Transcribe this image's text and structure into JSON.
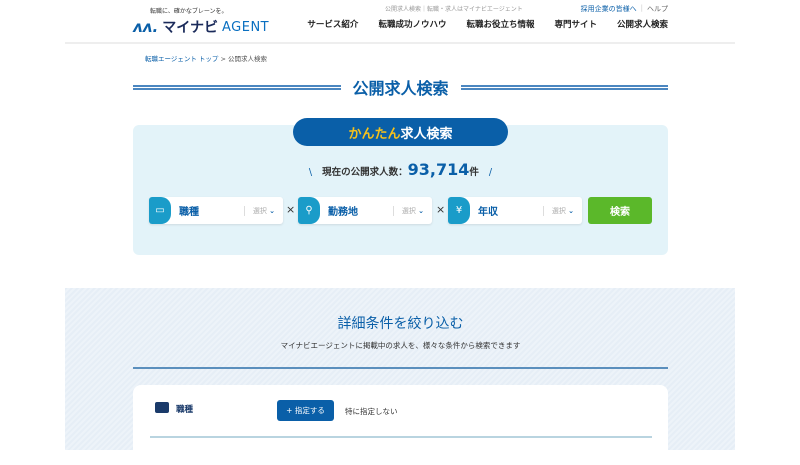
{
  "header": {
    "tagline": "転職に、確かなブレーンを。",
    "logo": {
      "brand": "マイナビ",
      "suffix": "AGENT"
    },
    "meta_text": "公開求人検索｜転職・求人はマイナビエージェント",
    "recruiter_link": "採用企業の皆様へ",
    "help_link": "ヘルプ",
    "nav": [
      "サービス紹介",
      "転職成功ノウハウ",
      "転職お役立ち情報",
      "専門サイト",
      "公開求人検索"
    ]
  },
  "breadcrumb": {
    "home": "転職エージェント トップ",
    "separator": ">",
    "current": "公開求人検索"
  },
  "page_title": "公開求人検索",
  "quick_search": {
    "title_highlight": "かんたん",
    "title_rest": "求人検索",
    "count_label": "現在の公開求人数：",
    "count_value": "93,714",
    "count_unit": "件",
    "slash_left": "\\",
    "slash_right": "/",
    "fields": [
      {
        "icon": "briefcase-icon",
        "label": "職種",
        "picker": "選択"
      },
      {
        "icon": "person-pin-icon",
        "label": "勤務地",
        "picker": "選択"
      },
      {
        "icon": "yen-icon",
        "label": "年収",
        "picker": "選択"
      }
    ],
    "times": "×",
    "search_button": "検索"
  },
  "detail": {
    "heading": "詳細条件を絞り込む",
    "subtext": "マイナビエージェントに掲載中の求人を、様々な条件から検索できます",
    "rows": [
      {
        "label": "職種",
        "button": "+ 指定する",
        "value": "特に指定しない"
      }
    ]
  }
}
